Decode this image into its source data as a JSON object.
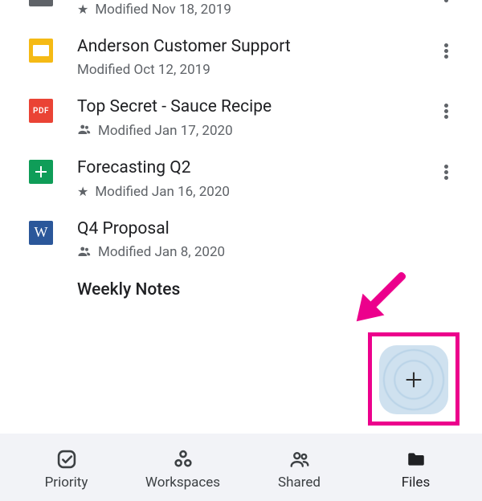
{
  "files": [
    {
      "title": "",
      "meta": "Modified Nov 18, 2019",
      "meta_icon": "star",
      "icon_type": "gray"
    },
    {
      "title": "Anderson Customer Support",
      "meta": "Modified Oct 12, 2019",
      "meta_icon": "none",
      "icon_type": "slides"
    },
    {
      "title": "Top Secret - Sauce Recipe",
      "meta": "Modified Jan 17, 2020",
      "meta_icon": "shared",
      "icon_type": "pdf",
      "icon_label": "PDF"
    },
    {
      "title": "Forecasting Q2",
      "meta": "Modified Jan 16, 2020",
      "meta_icon": "star",
      "icon_type": "sheets"
    },
    {
      "title": "Q4 Proposal",
      "meta": "Modified Jan 8, 2020",
      "meta_icon": "shared",
      "icon_type": "word",
      "icon_label": "W"
    },
    {
      "title": "Weekly Notes",
      "meta": "",
      "meta_icon": "none",
      "icon_type": "gray"
    }
  ],
  "fab": {
    "label": "+"
  },
  "nav": {
    "items": [
      {
        "label": "Priority",
        "icon": "priority"
      },
      {
        "label": "Workspaces",
        "icon": "workspaces"
      },
      {
        "label": "Shared",
        "icon": "shared"
      },
      {
        "label": "Files",
        "icon": "files",
        "active": true
      }
    ]
  },
  "annotation": {
    "color": "#ec008c"
  }
}
